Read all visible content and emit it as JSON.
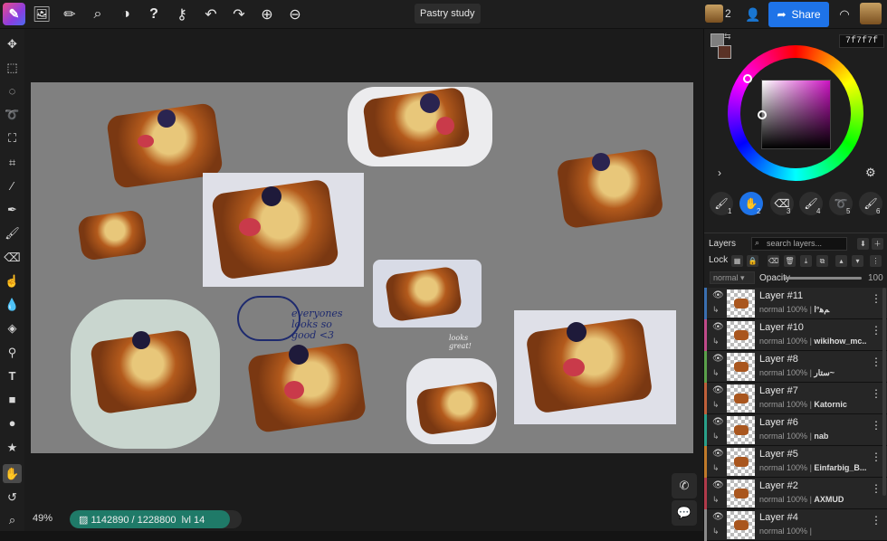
{
  "app": {
    "logo_icon": "paint-app-logo"
  },
  "toolbar": {
    "icons": [
      "image-icon",
      "pencil-icon",
      "search-icon",
      "contrast-icon",
      "help-icon",
      "key-icon",
      "undo-icon",
      "redo-icon",
      "zoom-in-icon",
      "zoom-out-icon"
    ],
    "document_title": "Pastry study",
    "user_count": "2",
    "share_label": "Share"
  },
  "tools": [
    "move",
    "select-rect",
    "select-ellipse",
    "lasso",
    "transform",
    "crop",
    "eyedropper",
    "pen",
    "brush",
    "eraser",
    "smudge",
    "blur",
    "fill",
    "stamp",
    "text",
    "rectangle",
    "ellipse",
    "star",
    "hand",
    "rotate",
    "zoom"
  ],
  "status": {
    "zoom": "49%",
    "pixels": "1142890 / 1228800",
    "level": "lvl 14",
    "pixel_fraction": 0.93
  },
  "canvas": {
    "sketch_text": "everyones\nlooks so\ngood <3",
    "small_note": "looks\ngreat!"
  },
  "color": {
    "hex": "7f7f7f",
    "primary": "#7f7f7f",
    "secondary": "#5a3226"
  },
  "brushes": [
    {
      "num": "1"
    },
    {
      "num": "2"
    },
    {
      "num": "3"
    },
    {
      "num": "4"
    },
    {
      "num": "5"
    },
    {
      "num": "6"
    }
  ],
  "layers_panel": {
    "title": "Layers",
    "search_placeholder": "search layers...",
    "lock_label": "Lock",
    "blend_mode": "normal",
    "opacity_label": "Opacity",
    "opacity_value": "100",
    "layers": [
      {
        "name": "Layer #11",
        "mode": "normal",
        "opacity": "100%",
        "author": "ﻢﻫ°ا",
        "color": "#3a6fb0"
      },
      {
        "name": "Layer #10",
        "mode": "normal",
        "opacity": "100%",
        "author": "wikihow_mc...",
        "color": "#c04a8a"
      },
      {
        "name": "Layer #8",
        "mode": "normal",
        "opacity": "100%",
        "author": "ﺳﺘﺎﺭ~",
        "color": "#5aa04a"
      },
      {
        "name": "Layer #7",
        "mode": "normal",
        "opacity": "100%",
        "author": "Katornic",
        "color": "#c0603a"
      },
      {
        "name": "Layer #6",
        "mode": "normal",
        "opacity": "100%",
        "author": "nab",
        "color": "#2aa08a"
      },
      {
        "name": "Layer #5",
        "mode": "normal",
        "opacity": "100%",
        "author": "Einfarbig_B...",
        "color": "#c07a2a"
      },
      {
        "name": "Layer #2",
        "mode": "normal",
        "opacity": "100%",
        "author": "AXMUD",
        "color": "#b03a4a"
      },
      {
        "name": "Layer #4",
        "mode": "normal",
        "opacity": "100%",
        "author": "",
        "color": "#8a8a8a"
      }
    ]
  }
}
